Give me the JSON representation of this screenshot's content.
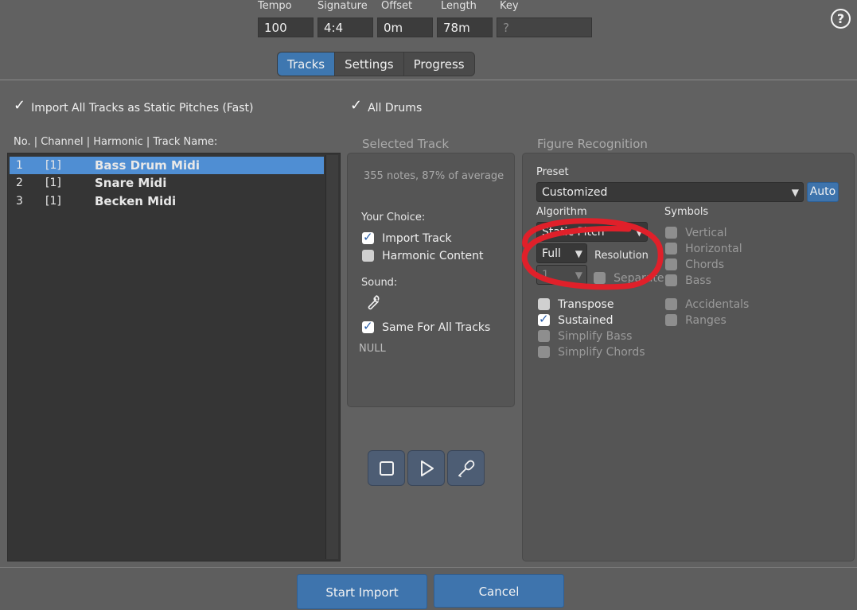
{
  "header": {
    "fields": [
      {
        "label": "Tempo",
        "value": "100"
      },
      {
        "label": "Signature",
        "value": "4:4"
      },
      {
        "label": "Offset",
        "value": "0m"
      },
      {
        "label": "Length",
        "value": "78m"
      },
      {
        "label": "Key",
        "value": "?"
      }
    ],
    "help_label": "?"
  },
  "tabs": [
    "Tracks",
    "Settings",
    "Progress"
  ],
  "options": {
    "import_all_static": "Import All Tracks as Static Pitches (Fast)",
    "all_drums": "All Drums"
  },
  "tracklist": {
    "header": "No. | Channel | Harmonic | Track Name:",
    "rows": [
      {
        "no": "1",
        "channel": "[1]",
        "name": "Bass Drum Midi"
      },
      {
        "no": "2",
        "channel": "[1]",
        "name": "Snare Midi"
      },
      {
        "no": "3",
        "channel": "[1]",
        "name": "Becken Midi"
      }
    ]
  },
  "selected_track": {
    "title": "Selected Track",
    "stats": "355 notes, 87% of average",
    "your_choice": "Your Choice:",
    "import_track": "Import Track",
    "harmonic_content": "Harmonic Content",
    "sound": "Sound:",
    "same_for_all": "Same For All Tracks",
    "sound_value": "NULL"
  },
  "figure": {
    "title": "Figure Recognition",
    "preset_label": "Preset",
    "preset_value": "Customized",
    "auto": "Auto",
    "algorithm_label": "Algorithm",
    "algorithm_value": "Static Pitch",
    "full_value": "Full",
    "resolution_label": "Resolution",
    "resolution_value": "1",
    "separate": "Separate",
    "symbols_label": "Symbols",
    "symbols": [
      "Vertical",
      "Horizontal",
      "Chords",
      "Bass"
    ],
    "transpose": "Transpose",
    "sustained": "Sustained",
    "simplify_bass": "Simplify Bass",
    "simplify_chords": "Simplify Chords",
    "accidentals": "Accidentals",
    "ranges": "Ranges"
  },
  "footer": {
    "start": "Start Import",
    "cancel": "Cancel"
  },
  "colors": {
    "accent": "#3e77b0",
    "selection": "#4f8ed3",
    "annotation": "#e0202a"
  }
}
